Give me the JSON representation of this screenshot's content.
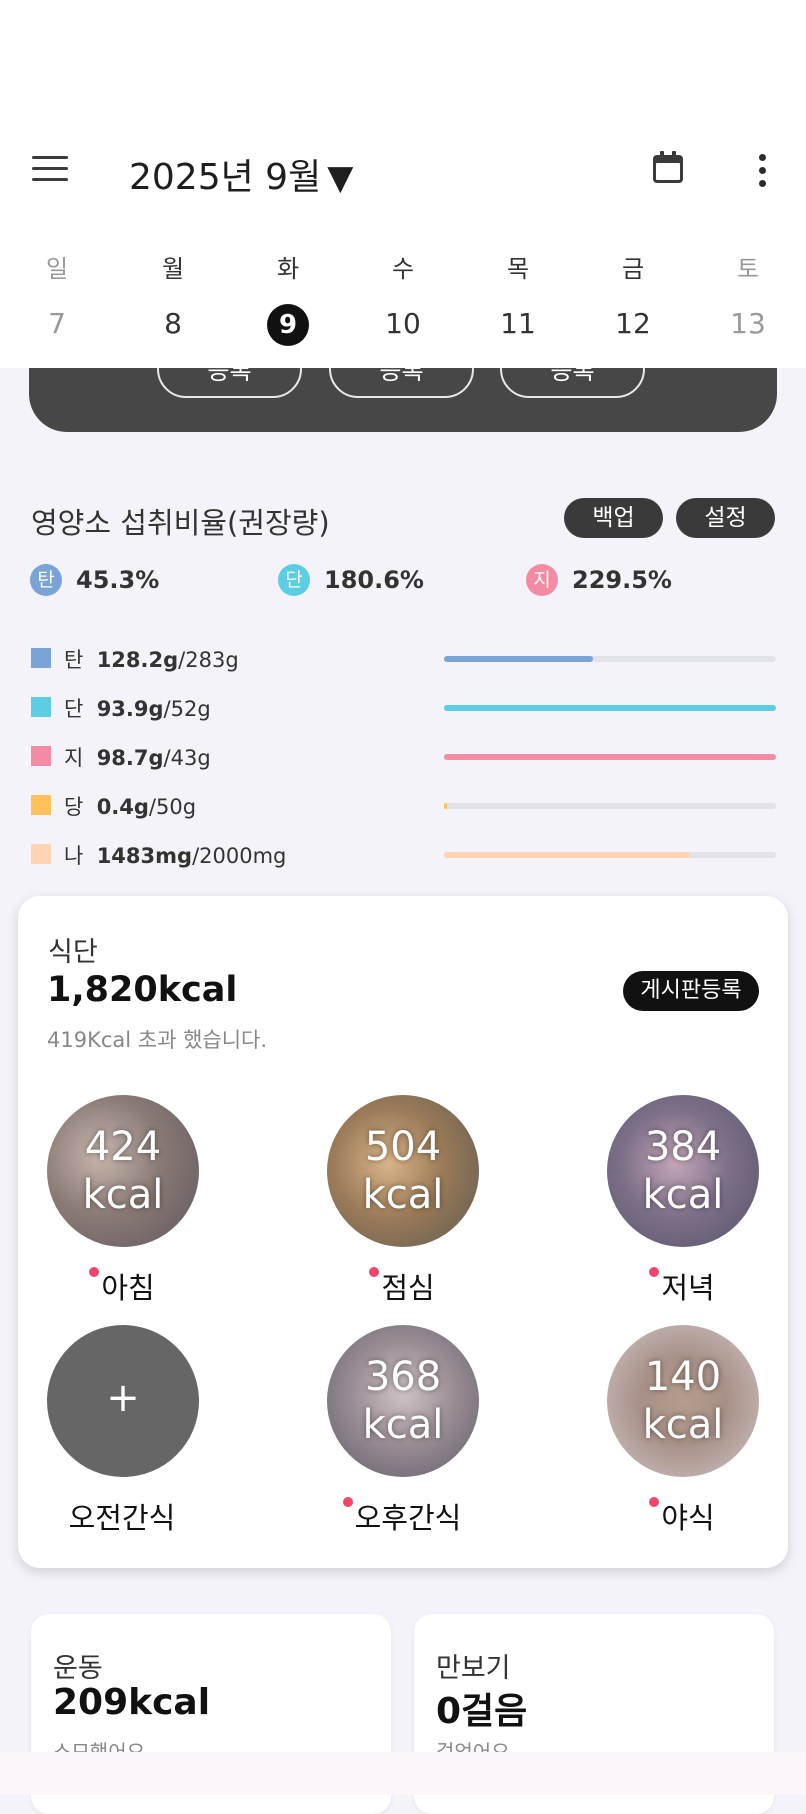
{
  "header": {
    "title": "2025년 9월",
    "arrow": "▼"
  },
  "week": [
    {
      "label": "일",
      "day": "7"
    },
    {
      "label": "월",
      "day": "8"
    },
    {
      "label": "화",
      "day": "9"
    },
    {
      "label": "수",
      "day": "10"
    },
    {
      "label": "목",
      "day": "11"
    },
    {
      "label": "금",
      "day": "12"
    },
    {
      "label": "토",
      "day": "13"
    }
  ],
  "dark_card": {
    "buttons": [
      "등록",
      "등록",
      "등록"
    ]
  },
  "nutrients": {
    "title": "영양소 섭취비율(권장량)",
    "backup_label": "백업",
    "settings_label": "설정",
    "ratios": [
      {
        "badge": "탄",
        "value": "45.3%",
        "color": "#7aa3d6"
      },
      {
        "badge": "단",
        "value": "180.6%",
        "color": "#5ccde3"
      },
      {
        "badge": "지",
        "value": "229.5%",
        "color": "#f28ba3"
      }
    ],
    "rows": [
      {
        "name": "탄",
        "amount": "128.2g",
        "target": "/283g",
        "color": "#7aa3d6",
        "fill": 0.45
      },
      {
        "name": "단",
        "amount": "93.9g",
        "target": "/52g",
        "color": "#5ccde3",
        "fill": 1.0
      },
      {
        "name": "지",
        "amount": "98.7g",
        "target": "/43g",
        "color": "#f28ba3",
        "fill": 1.0
      },
      {
        "name": "당",
        "amount": "0.4g",
        "target": "/50g",
        "color": "#ffc25a",
        "fill": 0.01
      },
      {
        "name": "나",
        "amount": "1483mg",
        "target": "/2000mg",
        "color": "#ffd3b3",
        "fill": 0.74
      }
    ]
  },
  "diet": {
    "label": "식단",
    "total": "1,820kcal",
    "board_label": "게시판등록",
    "note": "419Kcal 초과 했습니다.",
    "meals": [
      {
        "name": "아침",
        "kcal": "424",
        "unit": "kcal"
      },
      {
        "name": "점심",
        "kcal": "504",
        "unit": "kcal"
      },
      {
        "name": "저녁",
        "kcal": "384",
        "unit": "kcal"
      },
      {
        "name": "오전간식",
        "plus": "+"
      },
      {
        "name": "오후간식",
        "kcal": "368",
        "unit": "kcal"
      },
      {
        "name": "야식",
        "kcal": "140",
        "unit": "kcal"
      }
    ]
  },
  "exercise": {
    "title": "운동",
    "value": "209kcal",
    "sub": "소모했어요"
  },
  "steps": {
    "title": "만보기",
    "value": "0걸음",
    "sub": "걸었어요"
  }
}
